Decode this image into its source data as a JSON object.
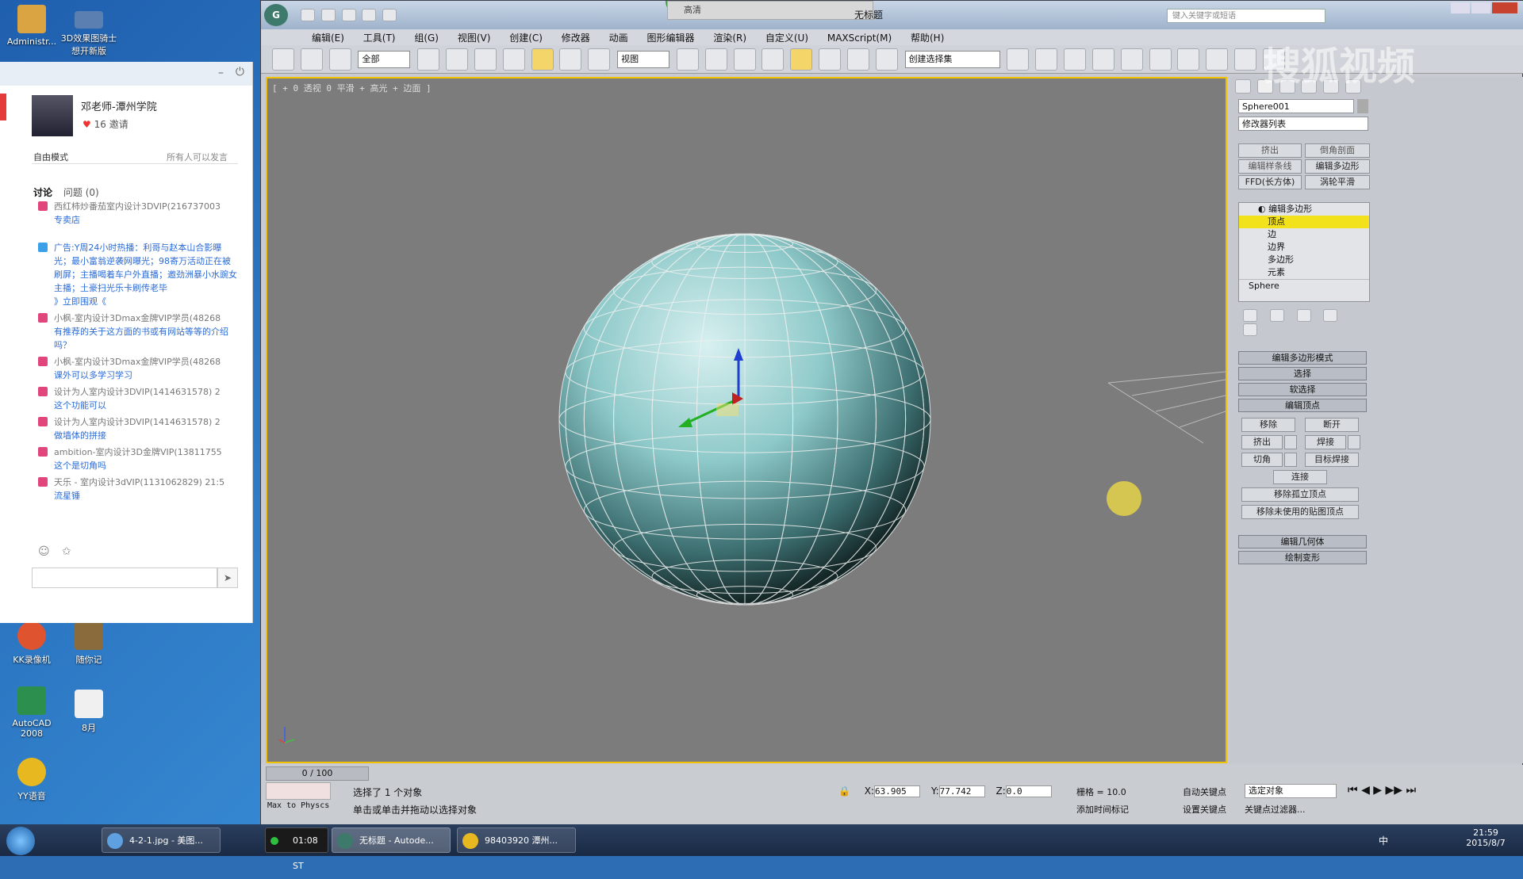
{
  "desktop": {
    "icons": [
      {
        "label": "Administr...",
        "color": "#d9a441"
      },
      {
        "label": "3D效果图骑士想开新版",
        "color": "#5a7fb0"
      },
      {
        "label": "KK录像机",
        "color": "#e0532f"
      },
      {
        "label": "随你记",
        "color": "#8a6b3c"
      },
      {
        "label": "AutoCAD 2008",
        "color": "#2d8f4e"
      },
      {
        "label": "8月",
        "color": "#f0f0f0"
      },
      {
        "label": "YY语音",
        "color": "#e8b820"
      }
    ]
  },
  "chat": {
    "user_name": "邓老师-潭州学院",
    "hearts": "16",
    "invite_label": "邀请",
    "mode_label": "自由模式",
    "mode_desc": "所有人可以发言",
    "tab_discuss": "讨论",
    "tab_question": "问题",
    "question_count": "(0)",
    "messages": [
      {
        "user": "西红柿炒番茄室内设计3DVIP(216737003",
        "text": "专卖店"
      },
      {
        "user": "广告:Y周24小时热播：利哥与赵本山合影曝光；最小富翁逆袭网曝光；98寄万活动正在被刷屏；主播喝着车户外直播；邀劲洲暴小水豌女主播；土豪扫光乐卡刷传老毕",
        "text": "》立即围观《"
      },
      {
        "user": "小枫-室内设计3Dmax金牌VIP学员(48268",
        "text": "有推荐的关于这方面的书或有网站等等的介绍吗？"
      },
      {
        "user": "小枫-室内设计3Dmax金牌VIP学员(48268",
        "text": "课外可以多学习学习"
      },
      {
        "user": "设计为人室内设计3DVIP(1414631578) 2",
        "text": "这个功能可以"
      },
      {
        "user": "设计为人室内设计3DVIP(1414631578) 2",
        "text": "做墙体的拼接"
      },
      {
        "user": "ambition-室内设计3D金牌VIP(13811755",
        "text": "这个是切角吗"
      },
      {
        "user": "天乐 - 室内设计3dVIP(1131062829) 21:5",
        "text": "流星锤"
      }
    ]
  },
  "max": {
    "title": "无标题",
    "search_placeholder": "键入关键字或短语",
    "quality_label": "高清",
    "menus": [
      "编辑(E)",
      "工具(T)",
      "组(G)",
      "视图(V)",
      "创建(C)",
      "修改器",
      "动画",
      "图形编辑器",
      "渲染(R)",
      "自定义(U)",
      "MAXScript(M)",
      "帮助(H)"
    ],
    "toolbar": {
      "filter": "全部",
      "view": "视图",
      "selection_set": "创建选择集"
    },
    "viewport_label": "[ + 0 透视 0 平滑 + 高光 + 边面 ]",
    "cmd": {
      "object_name": "Sphere001",
      "modifier_list": "修改器列表",
      "mod_buttons": [
        "挤出",
        "倒角剖面",
        "编辑样条线",
        "编辑多边形",
        "FFD(长方体)",
        "涡轮平滑"
      ],
      "stack": {
        "title": "编辑多边形",
        "items": [
          "顶点",
          "边",
          "边界",
          "多边形",
          "元素"
        ],
        "base": "Sphere"
      },
      "rollouts": [
        "编辑多边形模式",
        "选择",
        "软选择",
        "编辑顶点"
      ],
      "edit_vertex": {
        "remove": "移除",
        "break": "断开",
        "extrude": "挤出",
        "weld": "焊接",
        "chamfer": "切角",
        "target_weld": "目标焊接",
        "connect": "连接",
        "remove_isolated": "移除孤立顶点",
        "remove_unused": "移除未使用的贴图顶点"
      },
      "rollouts_bottom": [
        "编辑几何体",
        "绘制变形"
      ]
    },
    "status": {
      "frame": "0 / 100",
      "selected": "选择了 1 个对象",
      "hint": "单击或单击并拖动以选择对象",
      "maxscript": "Max to Physcs",
      "x": "63.905",
      "y": "77.742",
      "z": "0.0",
      "grid": "栅格 = 10.0",
      "add_time_tag": "添加时间标记",
      "auto_key": "自动关键点",
      "set_key": "设置关键点",
      "selected_obj": "选定对象",
      "key_filter": "关键点过滤器..."
    }
  },
  "watermark": "搜狐视频",
  "taskbar": {
    "tasks": [
      {
        "label": "4-2-1.jpg - 美图..."
      },
      {
        "label": "01:08 ST"
      },
      {
        "label": "无标题 - Autode..."
      },
      {
        "label": "98403920 潭州..."
      }
    ],
    "time": "21:59",
    "date": "2015/8/7",
    "ime": "中"
  }
}
